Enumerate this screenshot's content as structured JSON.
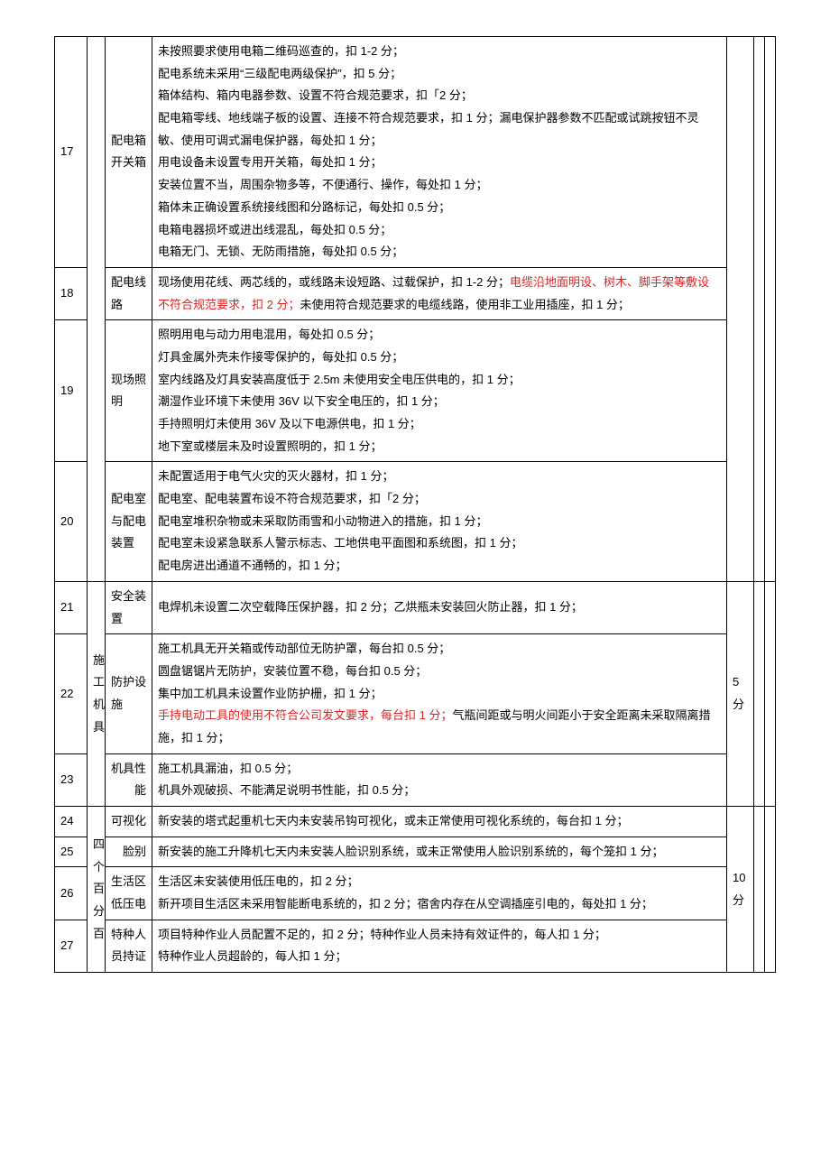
{
  "rows": [
    {
      "num": "17",
      "sub": "配电箱开关箱",
      "desc_plain": "未按照要求使用电箱二维码巡查的，扣 1-2 分；\n配电系统未采用“三级配电两级保护”，扣 5 分；\n箱体结构、箱内电器参数、设置不符合规范要求，扣「2 分；\n配电箱零线、地线端子板的设置、连接不符合规范要求，扣 1 分；漏电保护器参数不匹配或试跳按钮不灵敏、使用可调式漏电保护器，每处扣 1 分；\n用电设备未设置专用开关箱，每处扣 1 分；\n安装位置不当，周围杂物多等，不便通行、操作，每处扣 1 分；\n箱体未正确设置系统接线图和分路标记，每处扣 0.5 分；\n电箱电器损坏或进出线混乱，每处扣 0.5 分；\n电箱无门、无锁、无防雨措施，每处扣 0.5 分；"
    },
    {
      "num": "18",
      "sub": "配电线路",
      "desc_segments": [
        {
          "t": "现场使用花线、两芯线的，或线路未设短路、过载保护，扣 1-2 分；"
        },
        {
          "t": "电缆沿地面明设、树木、脚手架等敷设不符合规范要求，扣 2 分；",
          "red": true
        },
        {
          "t": "未使用符合规范要求的电缆线路，使用非工业用插座，扣 1 分；"
        }
      ]
    },
    {
      "num": "19",
      "sub": "现场照明",
      "desc_plain": "照明用电与动力用电混用，每处扣 0.5 分；\n灯具金属外壳未作接零保护的，每处扣 0.5 分；\n室内线路及灯具安装高度低于 2.5m 未使用安全电压供电的，扣 1 分；\n潮湿作业环境下未使用 36V 以下安全电压的，扣 1 分；\n手持照明灯未使用 36V 及以下电源供电，扣 1 分；\n地下室或楼层未及时设置照明的，扣 1 分；"
    },
    {
      "num": "20",
      "sub": "配电室与配电装置",
      "desc_plain": "未配置适用于电气火灾的灭火器材，扣 1 分；\n配电室、配电装置布设不符合规范要求，扣「2 分；\n配电室堆积杂物或未采取防雨雪和小动物进入的措施，扣 1 分；\n配电室未设紧急联系人警示标志、工地供电平面图和系统图，扣 1 分；\n配电房进出通道不通畅的，扣 1 分；"
    },
    {
      "num": "21",
      "sub": "安全装置",
      "desc_plain": "电焊机未设置二次空载降压保护器，扣 2 分；乙烘瓶未安装回火防止器，扣 1 分；"
    },
    {
      "num": "22",
      "sub": "防护设施",
      "cat": "施工机具",
      "score": "5 分",
      "desc_segments": [
        {
          "t": "施工机具无开关箱或传动部位无防护罩，每台扣 0.5 分；\n圆盘锯锯片无防护，安装位置不稳，每台扣 0.5 分；\n集中加工机具未设置作业防护栅，扣 1 分；\n"
        },
        {
          "t": "手持电动工具的使用不符合公司发文要求，每台扣 1 分；",
          "red": true
        },
        {
          "t": "气瓶间距或与明火间距小于安全距离未采取隔离措施，扣 1 分；"
        }
      ]
    },
    {
      "num": "23",
      "sub": "机具性能",
      "sub_align": "right",
      "desc_plain": "施工机具漏油，扣 0.5 分；\n机具外观破损、不能满足说明书性能，扣 0.5 分；"
    },
    {
      "num": "24",
      "sub": "可视化",
      "desc_plain": "新安装的塔式起重机七天内未安装吊钩可视化，或未正常使用可视化系统的，每台扣 1 分；"
    },
    {
      "num": "25",
      "sub": "脸别",
      "sub_align": "right",
      "desc_plain": "新安装的施工升降机七天内未安装人脸识别系统，或未正常使用人脸识别系统的，每个笼扣 1 分；"
    },
    {
      "num": "26",
      "sub": "生活区低压电",
      "cat": "四个百分百",
      "score": "10 分",
      "desc_plain": "生活区未安装使用低压电的，扣 2 分；\n新开项目生活区未采用智能断电系统的，扣 2 分；宿舍内存在从空调插座引电的，每处扣 1 分；"
    },
    {
      "num": "27",
      "sub": "特种人员持证",
      "desc_plain": "项目特种作业人员配置不足的，扣 2 分；特种作业人员未持有效证件的，每人扣 1 分；\n特种作业人员超龄的，每人扣 1 分；"
    }
  ]
}
